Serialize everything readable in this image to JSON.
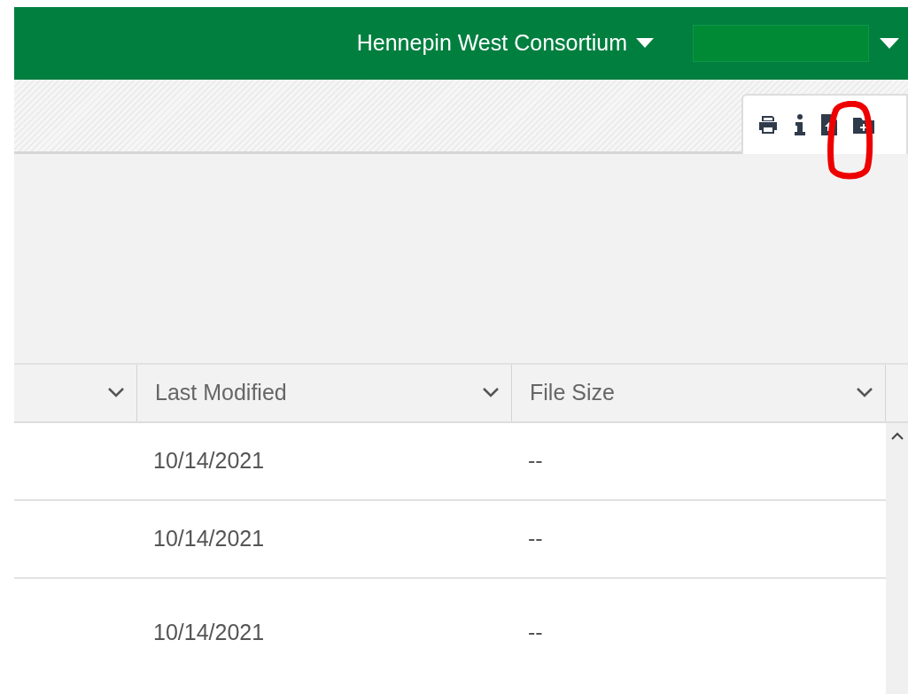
{
  "header": {
    "org_menu": {
      "label": "Hennepin West Consortium"
    }
  },
  "table": {
    "columns": [
      {
        "sortable": true
      },
      {
        "label": "Last Modified",
        "sortable": true
      },
      {
        "label": "File Size",
        "sortable": true
      }
    ],
    "rows": [
      {
        "last_modified": "10/14/2021",
        "file_size": "--"
      },
      {
        "last_modified": "10/14/2021",
        "file_size": "--"
      },
      {
        "last_modified": "10/14/2021",
        "file_size": "--"
      }
    ]
  }
}
